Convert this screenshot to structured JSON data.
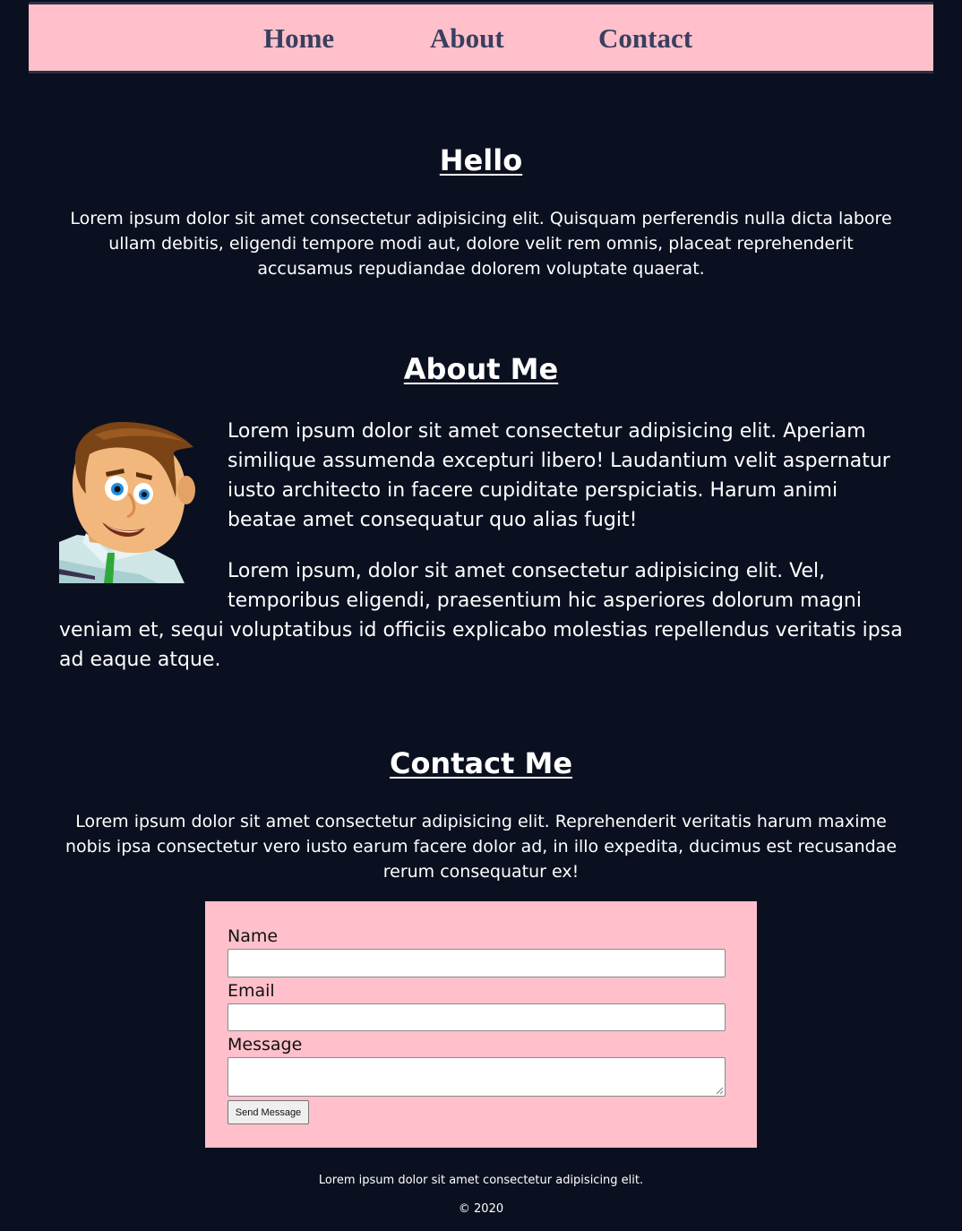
{
  "nav": {
    "home": "Home",
    "about": "About",
    "contact": "Contact"
  },
  "hello": {
    "title": "Hello",
    "text": "Lorem ipsum dolor sit amet consectetur adipisicing elit. Quisquam perferendis nulla dicta labore ullam debitis, eligendi tempore modi aut, dolore velit rem omnis, placeat reprehenderit accusamus repudiandae dolorem voluptate quaerat."
  },
  "about": {
    "title": "About Me",
    "paragraph1": "Lorem ipsum dolor sit amet consectetur adipisicing elit. Aperiam similique assumenda excepturi libero! Laudantium velit aspernatur iusto architecto in facere cupiditate perspiciatis. Harum animi beatae amet consequatur quo alias fugit!",
    "paragraph2": "Lorem ipsum, dolor sit amet consectetur adipisicing elit. Vel, temporibus eligendi, praesentium hic asperiores dolorum magni veniam et, sequi voluptatibus id officiis explicabo molestias repellendus veritatis ipsa ad eaque atque."
  },
  "contact": {
    "title": "Contact Me",
    "text": "Lorem ipsum dolor sit amet consectetur adipisicing elit. Reprehenderit veritatis harum maxime nobis ipsa consectetur vero iusto earum facere dolor ad, in illo expedita, ducimus est recusandae rerum consequatur ex!",
    "form": {
      "name_label": "Name",
      "name_value": "",
      "email_label": "Email",
      "email_value": "",
      "message_label": "Message",
      "message_value": "",
      "submit_label": "Send Message"
    }
  },
  "footer": {
    "text": "Lorem ipsum dolor sit amet consectetur adipisicing elit.",
    "copyright": "© 2020"
  },
  "colors": {
    "page_background": "#0b1020",
    "accent_pink": "#ffc0cb",
    "nav_text": "#3a3f5f",
    "text": "#ffffff"
  }
}
